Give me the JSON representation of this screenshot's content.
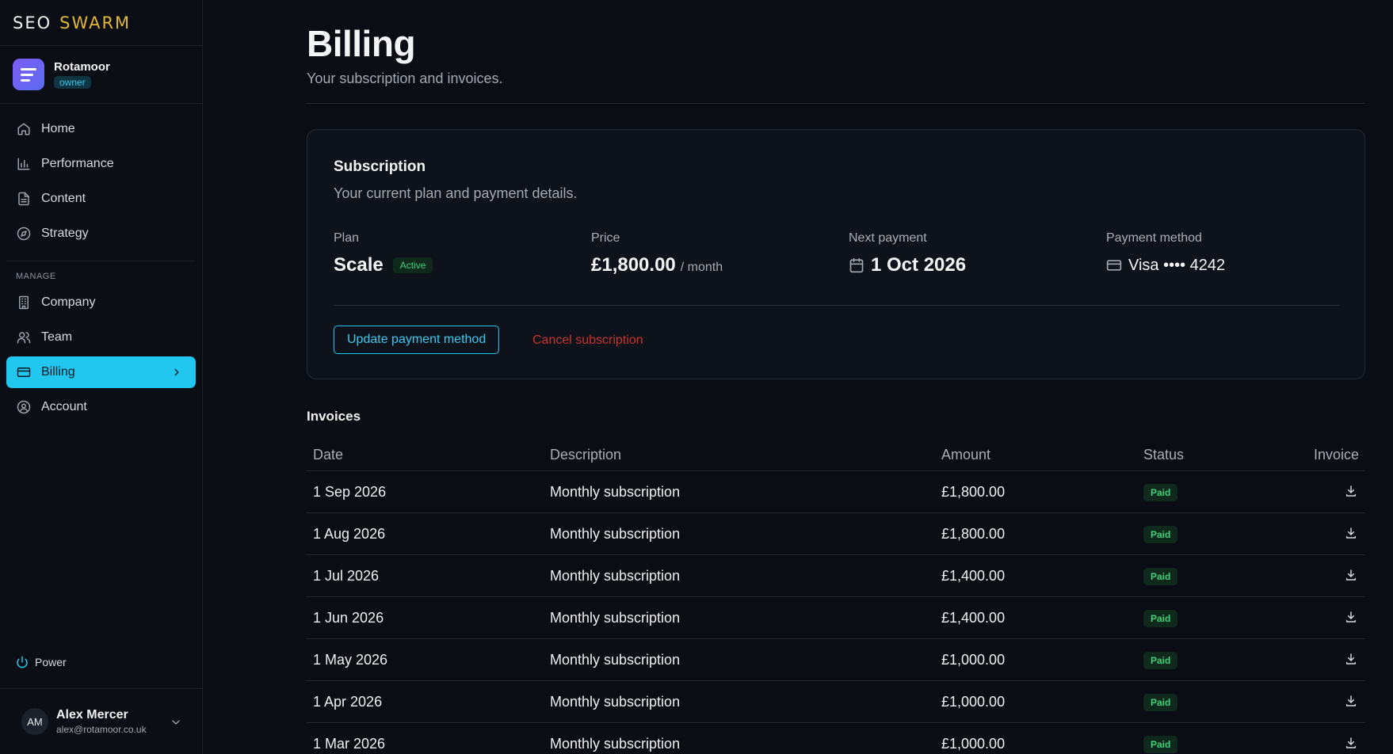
{
  "brand": {
    "seo": "SEO",
    "swarm": "SWARM"
  },
  "org": {
    "name": "Rotamoor",
    "role": "owner"
  },
  "nav": {
    "items": [
      {
        "label": "Home",
        "icon": "home-icon"
      },
      {
        "label": "Performance",
        "icon": "bar-chart-icon"
      },
      {
        "label": "Content",
        "icon": "document-icon"
      },
      {
        "label": "Strategy",
        "icon": "compass-icon"
      }
    ],
    "manage_heading": "MANAGE",
    "manage_items": [
      {
        "label": "Company",
        "icon": "building-icon"
      },
      {
        "label": "Team",
        "icon": "users-icon"
      },
      {
        "label": "Billing",
        "icon": "credit-card-icon",
        "active": true
      },
      {
        "label": "Account",
        "icon": "user-circle-icon"
      }
    ]
  },
  "power": {
    "label": "Power"
  },
  "user": {
    "initials": "AM",
    "name": "Alex Mercer",
    "email": "alex@rotamoor.co.uk"
  },
  "page": {
    "title": "Billing",
    "subtitle": "Your subscription and invoices."
  },
  "subscription": {
    "title": "Subscription",
    "subtitle": "Your current plan and payment details.",
    "plan_label": "Plan",
    "plan_value": "Scale",
    "plan_status": "Active",
    "price_label": "Price",
    "price_value": "£1,800.00",
    "price_unit": "/ month",
    "next_label": "Next payment",
    "next_value": "1 Oct 2026",
    "method_label": "Payment method",
    "method_value": "Visa •••• 4242",
    "update_button": "Update payment method",
    "cancel_button": "Cancel subscription"
  },
  "invoices": {
    "title": "Invoices",
    "columns": [
      "Date",
      "Description",
      "Amount",
      "Status",
      "Invoice"
    ],
    "rows": [
      {
        "date": "1 Sep 2026",
        "description": "Monthly subscription",
        "amount": "£1,800.00",
        "status": "Paid"
      },
      {
        "date": "1 Aug 2026",
        "description": "Monthly subscription",
        "amount": "£1,800.00",
        "status": "Paid"
      },
      {
        "date": "1 Jul 2026",
        "description": "Monthly subscription",
        "amount": "£1,400.00",
        "status": "Paid"
      },
      {
        "date": "1 Jun 2026",
        "description": "Monthly subscription",
        "amount": "£1,400.00",
        "status": "Paid"
      },
      {
        "date": "1 May 2026",
        "description": "Monthly subscription",
        "amount": "£1,000.00",
        "status": "Paid"
      },
      {
        "date": "1 Apr 2026",
        "description": "Monthly subscription",
        "amount": "£1,000.00",
        "status": "Paid"
      },
      {
        "date": "1 Mar 2026",
        "description": "Monthly subscription",
        "amount": "£1,000.00",
        "status": "Paid"
      }
    ]
  },
  "colors": {
    "accent": "#22c7f0",
    "brand_gold": "#e2b735",
    "danger": "#c9322f",
    "success": "#3ed17a",
    "background": "#0a0d13"
  }
}
